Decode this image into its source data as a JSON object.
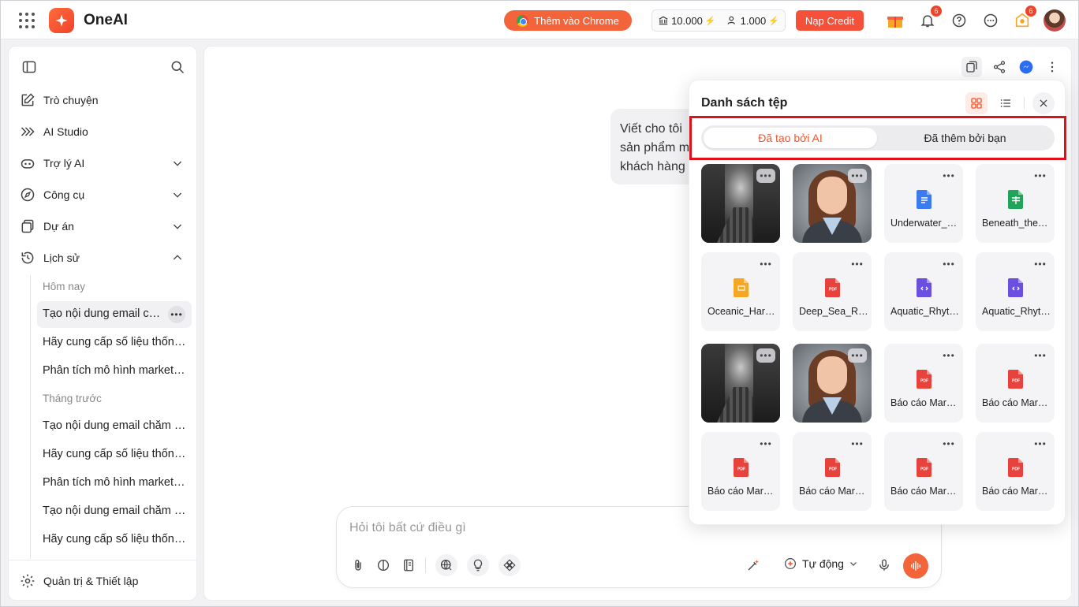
{
  "app": {
    "name": "OneAI"
  },
  "topbar": {
    "chrome_btn": "Thêm vào Chrome",
    "credit_a": "10.000",
    "credit_b": "1.000",
    "topup_btn": "Nạp Credit",
    "notif_badge": "6",
    "reward_badge": "6"
  },
  "sidebar": {
    "nav": [
      {
        "label": "Trò chuyện"
      },
      {
        "label": "AI Studio"
      },
      {
        "label": "Trợ lý AI"
      },
      {
        "label": "Công cụ"
      },
      {
        "label": "Dự án"
      },
      {
        "label": "Lịch sử"
      }
    ],
    "group_today": "Hôm nay",
    "today": [
      "Tạo nội dung email chăm sóc khách hàng",
      "Hãy cung cấp số liệu thống kê",
      "Phân tích mô hình marketing"
    ],
    "group_prev": "Tháng trước",
    "prev": [
      "Tạo nội dung email chăm sóc khách hàng",
      "Hãy cung cấp số liệu thống kê",
      "Phân tích mô hình marketing",
      "Tạo nội dung email chăm sóc khách hàng",
      "Hãy cung cấp số liệu thống kê"
    ],
    "settings": "Quản trị & Thiết lập"
  },
  "chat": {
    "message_lines": [
      "Viết cho tôi",
      "sản phẩm m",
      "khách hàng"
    ]
  },
  "composer": {
    "placeholder": "Hỏi tôi bất cứ điều gì",
    "mode": "Tự động"
  },
  "file_panel": {
    "title": "Danh sách tệp",
    "tab_ai": "Đã tạo bởi AI",
    "tab_user": "Đã thêm bởi bạn",
    "files": [
      {
        "kind": "image-street",
        "name": ""
      },
      {
        "kind": "image-portrait",
        "name": ""
      },
      {
        "kind": "doc",
        "name": "Underwater_Harmony",
        "color": "#3b7bf0"
      },
      {
        "kind": "sheet",
        "name": "Beneath_the_Waves",
        "color": "#21a35a"
      },
      {
        "kind": "ppt",
        "name": "Oceanic_Harmony",
        "color": "#f5a623"
      },
      {
        "kind": "pdf",
        "name": "Deep_Sea_Report",
        "color": "#e8423d"
      },
      {
        "kind": "code",
        "name": "Aquatic_Rhythm",
        "color": "#6a4fe0"
      },
      {
        "kind": "code",
        "name": "Aquatic_Rhythm",
        "color": "#6a4fe0"
      },
      {
        "kind": "image-street",
        "name": ""
      },
      {
        "kind": "image-portrait",
        "name": ""
      },
      {
        "kind": "pdf",
        "name": "Báo cáo Marketing",
        "color": "#e8423d"
      },
      {
        "kind": "pdf",
        "name": "Báo cáo Marketing",
        "color": "#e8423d"
      },
      {
        "kind": "pdf",
        "name": "Báo cáo Marketing",
        "color": "#e8423d"
      },
      {
        "kind": "pdf",
        "name": "Báo cáo Marketing",
        "color": "#e8423d"
      },
      {
        "kind": "pdf",
        "name": "Báo cáo Marketing",
        "color": "#e8423d"
      },
      {
        "kind": "pdf",
        "name": "Báo cáo Marketing",
        "color": "#e8423d"
      }
    ]
  },
  "colors": {
    "accent": "#f4643a",
    "highlight": "#e0101a"
  }
}
